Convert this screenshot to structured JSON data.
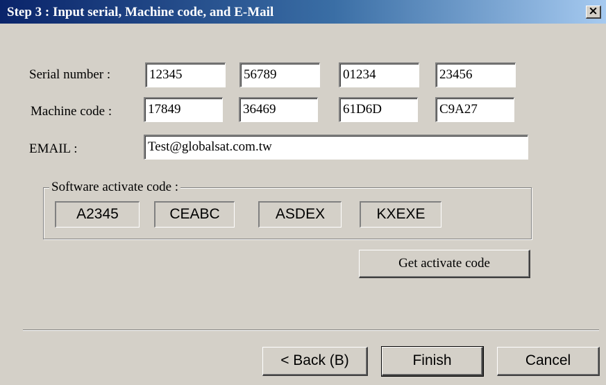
{
  "window": {
    "title": "Step 3 : Input serial, Machine code, and E-Mail",
    "close_glyph": "×"
  },
  "serial": {
    "label": "Serial number :",
    "parts": [
      "12345",
      "56789",
      "01234",
      "23456"
    ]
  },
  "machine": {
    "label": "Machine code :",
    "parts": [
      "17849",
      "36469",
      "61D6D",
      "C9A27"
    ]
  },
  "email": {
    "label": "EMAIL :",
    "value": "Test@globalsat.com.tw"
  },
  "activate": {
    "group_label": "Software activate code :",
    "codes": [
      "A2345",
      "CEABC",
      "ASDEX",
      "KXEXE"
    ],
    "button_label": "Get activate code"
  },
  "footer": {
    "back_label": "< Back (B)",
    "finish_label": "Finish",
    "cancel_label": "Cancel"
  }
}
